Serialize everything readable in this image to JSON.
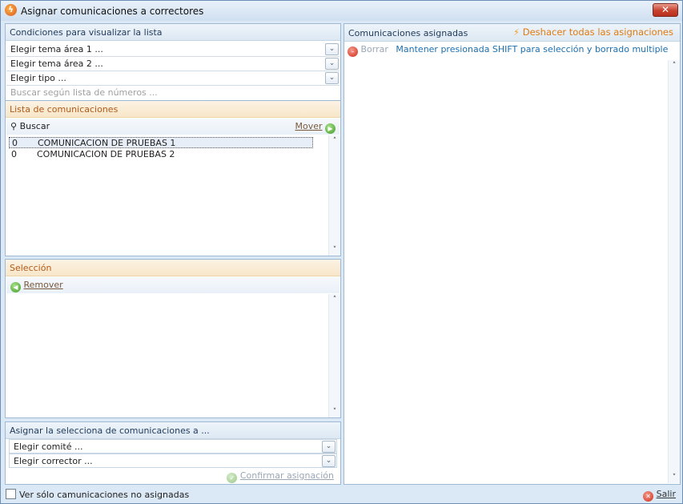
{
  "window": {
    "title": "Asignar comunicaciones a correctores",
    "close_glyph": "✕"
  },
  "conditions": {
    "header": "Condiciones para visualizar la lista",
    "combo_area1": "Elegir tema área 1 ...",
    "combo_area2": "Elegir tema área 2 ...",
    "combo_tipo": "Elegir tipo ...",
    "search_placeholder": "Buscar según lista de números ..."
  },
  "comunicaciones": {
    "header": "Lista de comunicaciones",
    "search_label": "Buscar",
    "move_label": "Mover",
    "rows": [
      {
        "num": "0",
        "name": "COMUNICACION DE PRUEBAS 1"
      },
      {
        "num": "0",
        "name": "COMUNICACION DE PRUEBAS 2"
      }
    ]
  },
  "seleccion": {
    "header": "Selección",
    "remove_label": "Remover"
  },
  "asignar": {
    "header": "Asignar la selecciona de comunicaciones a ...",
    "combo_comite": "Elegir comité ...",
    "combo_corrector": "Elegir corrector ...",
    "confirm_label": "Confirmar asignación"
  },
  "asignadas": {
    "header": "Comunicaciones asignadas",
    "undo_all": "Deshacer todas las asignaciones",
    "delete_label": "Borrar",
    "hint": "Mantener presionada SHIFT para selección y borrado multiple"
  },
  "footer": {
    "checkbox_label": "Ver sólo camunicaciones no asignadas",
    "exit_label": "Salir"
  }
}
